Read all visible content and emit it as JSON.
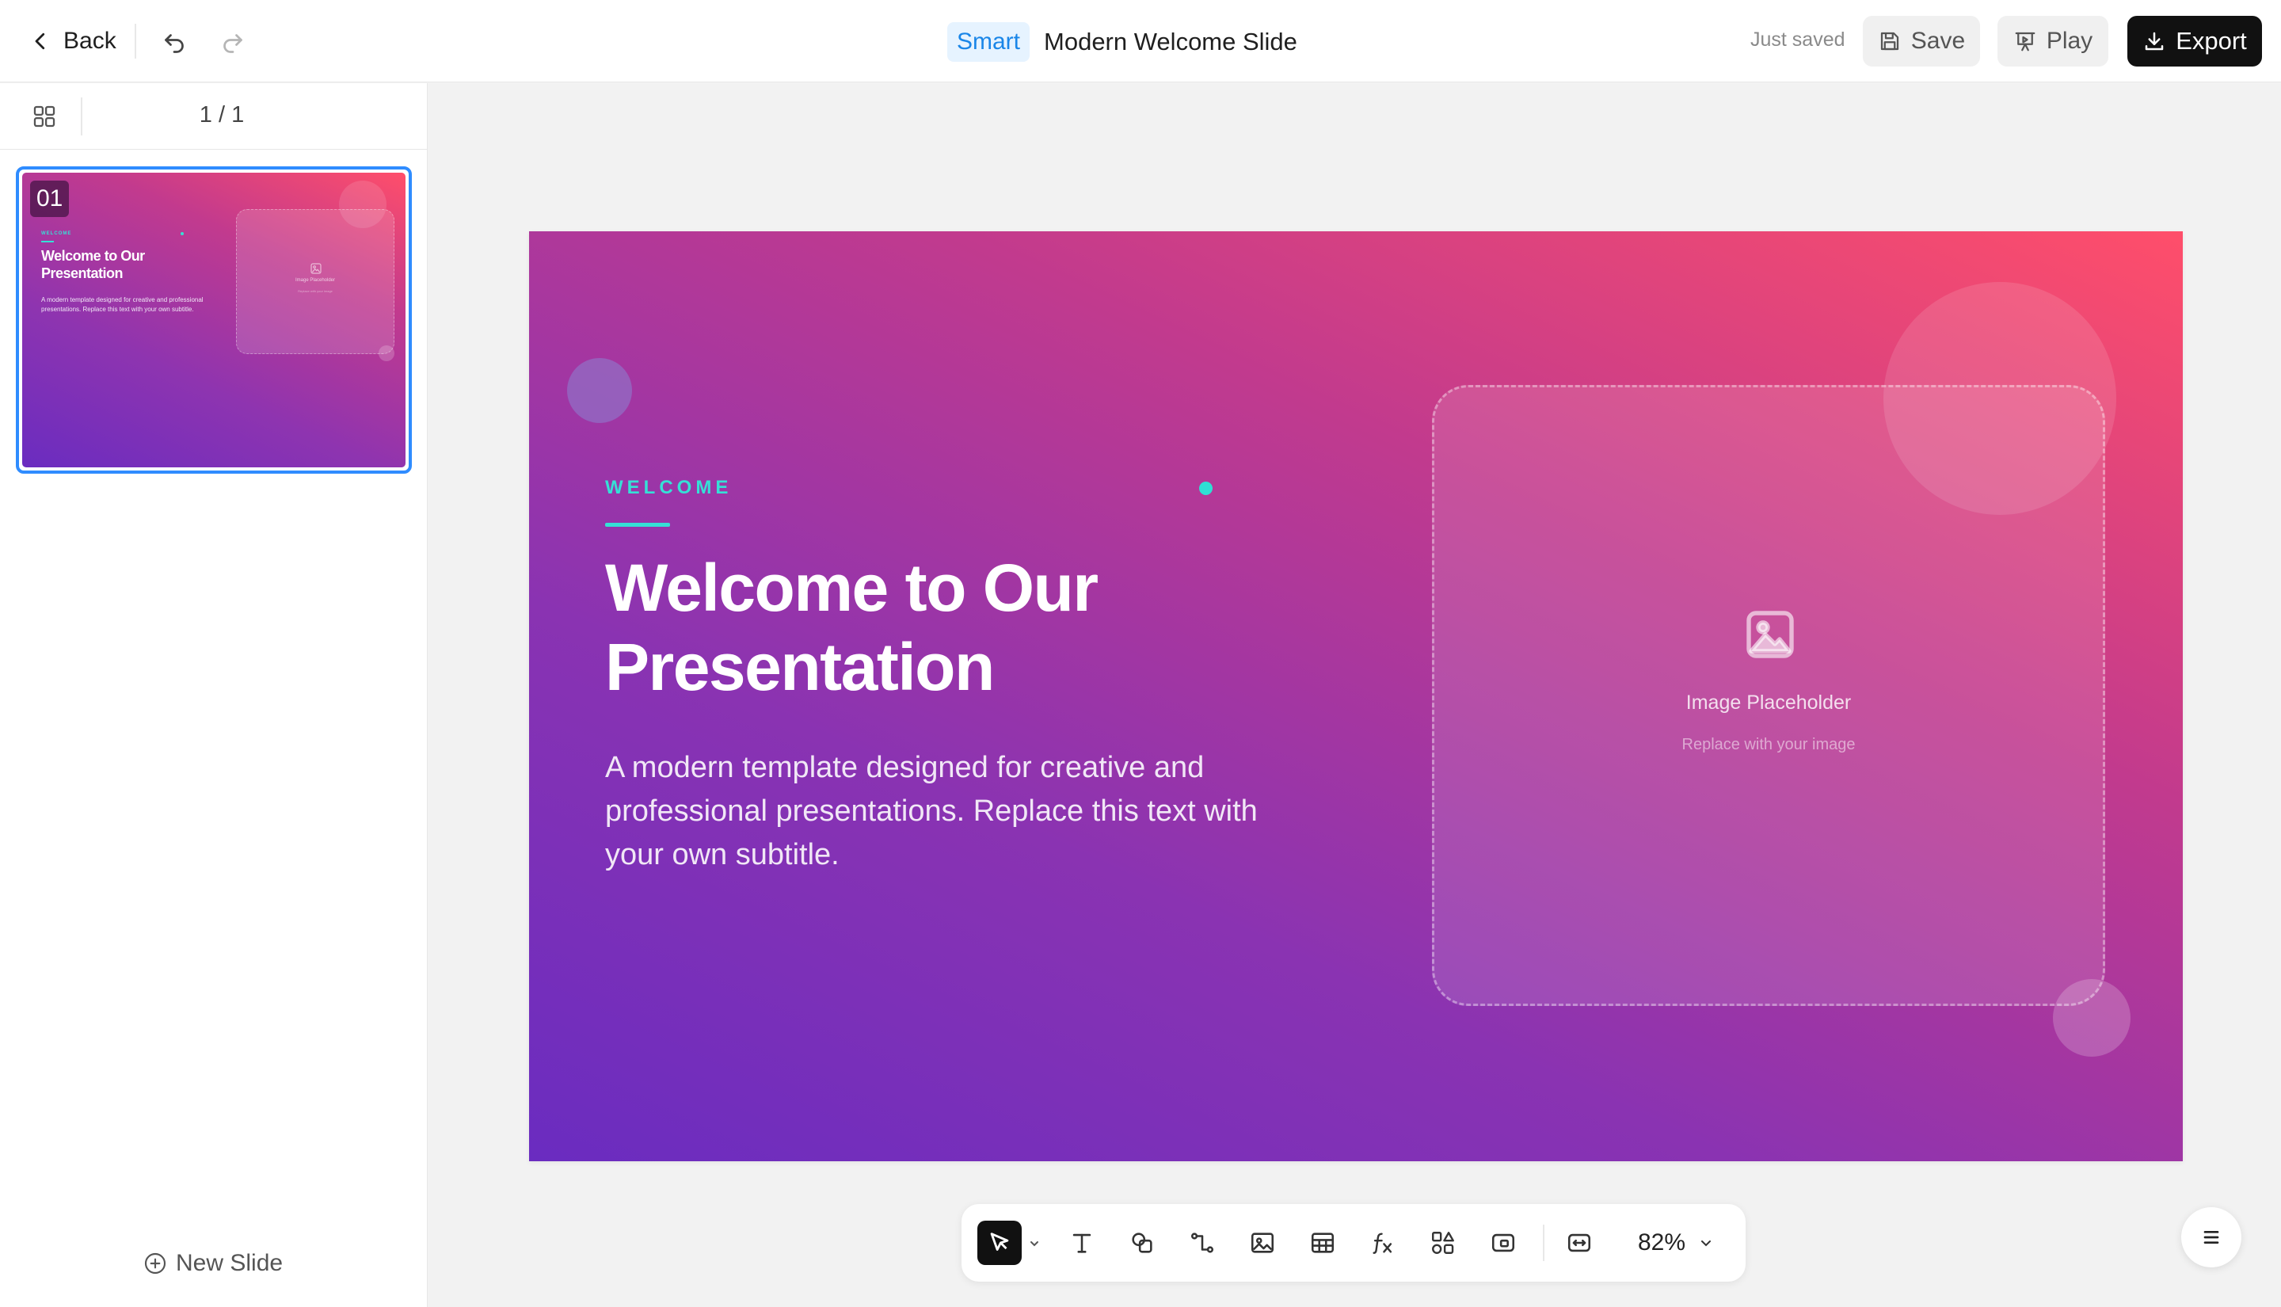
{
  "header": {
    "back_label": "Back",
    "smart_badge": "Smart",
    "doc_title": "Modern Welcome Slide",
    "save_status": "Just saved",
    "save_label": "Save",
    "play_label": "Play",
    "export_label": "Export"
  },
  "sidebar": {
    "page_count": "1 / 1",
    "new_slide_label": "New Slide",
    "thumbnails": [
      {
        "number": "01",
        "selected": true
      }
    ]
  },
  "slide": {
    "eyebrow": "WELCOME",
    "title": "Welcome to Our Presentation",
    "subtitle": "A modern template designed for creative and professional presentations. Replace this text with your own subtitle.",
    "placeholder_label": "Image Placeholder",
    "placeholder_sub": "Replace with your image",
    "colors": {
      "gradient_start": "#6a2cc0",
      "gradient_end": "#ff4e6a",
      "accent": "#35e0d6"
    }
  },
  "toolbar": {
    "zoom": "82%",
    "tools": [
      "select-icon",
      "text-icon",
      "shape-icon",
      "connector-icon",
      "image-icon",
      "table-icon",
      "formula-icon",
      "components-icon",
      "media-icon",
      "fit-icon"
    ]
  },
  "colors": {
    "accent_blue": "#2f8cff",
    "smart_badge_bg": "#e6f3ff",
    "smart_badge_text": "#1a86e8",
    "export_bg": "#111111"
  }
}
